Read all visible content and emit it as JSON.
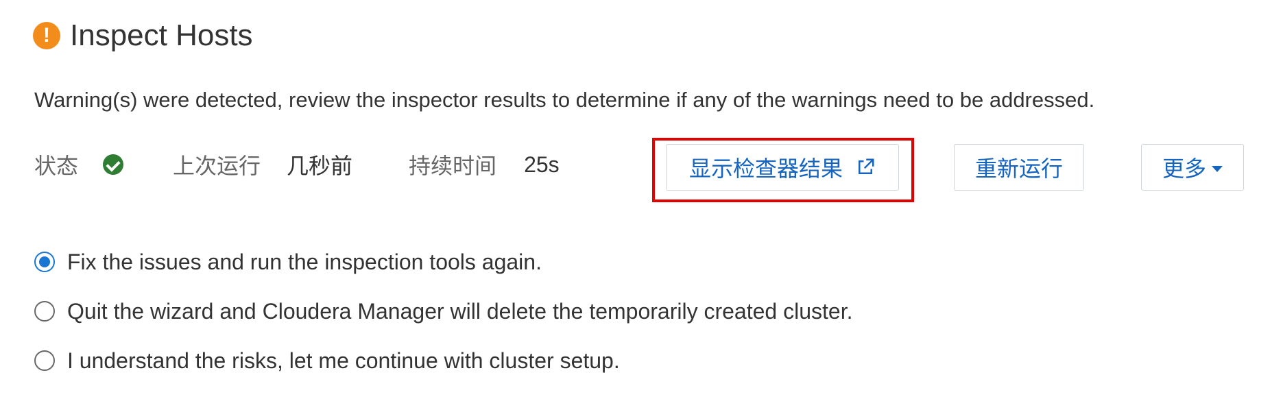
{
  "title": {
    "icon": "warning-exclamation-icon",
    "icon_glyph": "!",
    "text": "Inspect Hosts"
  },
  "warning_text": "Warning(s) were detected, review the inspector results to determine if any of the warnings need to be addressed.",
  "status_row": {
    "status_label": "状态",
    "status_icon": "check-circle-icon",
    "last_run_label": "上次运行",
    "last_run_value": "几秒前",
    "duration_label": "持续时间",
    "duration_value": "25s"
  },
  "buttons": {
    "show_results": "显示检查器结果",
    "show_results_icon": "external-link-icon",
    "rerun": "重新运行",
    "more": "更多",
    "more_icon": "caret-down-icon"
  },
  "options": [
    {
      "label": "Fix the issues and run the inspection tools again.",
      "selected": true
    },
    {
      "label": "Quit the wizard and Cloudera Manager will delete the temporarily created cluster.",
      "selected": false
    },
    {
      "label": "I understand the risks, let me continue with cluster setup.",
      "selected": false
    }
  ],
  "colors": {
    "warning_orange": "#f28c1b",
    "success_green": "#2e7d32",
    "link_blue": "#1565c0",
    "radio_blue": "#1976d2",
    "highlight_red": "#e00000"
  }
}
